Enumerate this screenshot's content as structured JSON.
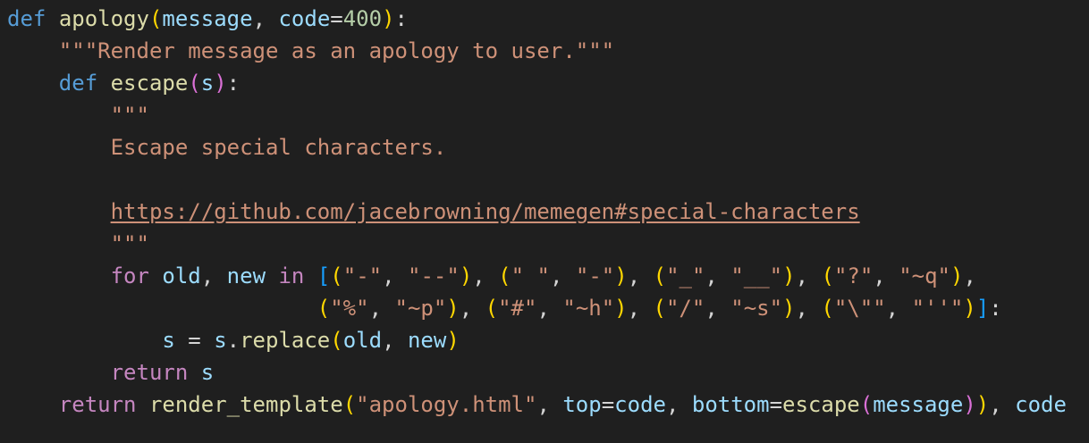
{
  "code": {
    "l1": {
      "def": "def",
      "fn": "apology",
      "open": "(",
      "p1": "message",
      "comma": ", ",
      "p2": "code",
      "eq": "=",
      "num": "400",
      "close": ")",
      "colon": ":"
    },
    "l2": {
      "doc": "\"\"\"Render message as an apology to user.\"\"\""
    },
    "l3": {
      "def": "def",
      "fn": "escape",
      "open": "(",
      "p1": "s",
      "close": ")",
      "colon": ":"
    },
    "l4": {
      "doc": "\"\"\""
    },
    "l5": {
      "doc": "Escape special characters."
    },
    "l7": {
      "link": "https://github.com/jacebrowning/memegen#special-characters"
    },
    "l8": {
      "doc": "\"\"\""
    },
    "l9": {
      "for": "for",
      "old": "old",
      "new": "new",
      "in": "in",
      "s1a": "\"-\"",
      "s1b": "\"--\"",
      "s2a": "\" \"",
      "s2b": "\"-\"",
      "s3a": "\"_\"",
      "s3b": "\"__\"",
      "s4a": "\"?\"",
      "s4b": "\"~q\""
    },
    "l10": {
      "s5a": "\"%\"",
      "s5b": "\"~p\"",
      "s6a": "\"#\"",
      "s6b": "\"~h\"",
      "s7a": "\"/\"",
      "s7b": "\"~s\"",
      "s8a": "\"\\\"\"",
      "s8b": "\"''\""
    },
    "l11": {
      "s": "s",
      "eq": " = ",
      "s2": "s",
      "dot": ".",
      "method": "replace",
      "old": "old",
      "new": "new"
    },
    "l12": {
      "ret": "return",
      "s": "s"
    },
    "l13": {
      "ret": "return",
      "fn": "render_template",
      "str": "\"apology.html\"",
      "top": "top",
      "code1": "code",
      "bottom": "bottom",
      "escape": "escape",
      "message": "message",
      "code2": "code"
    }
  }
}
